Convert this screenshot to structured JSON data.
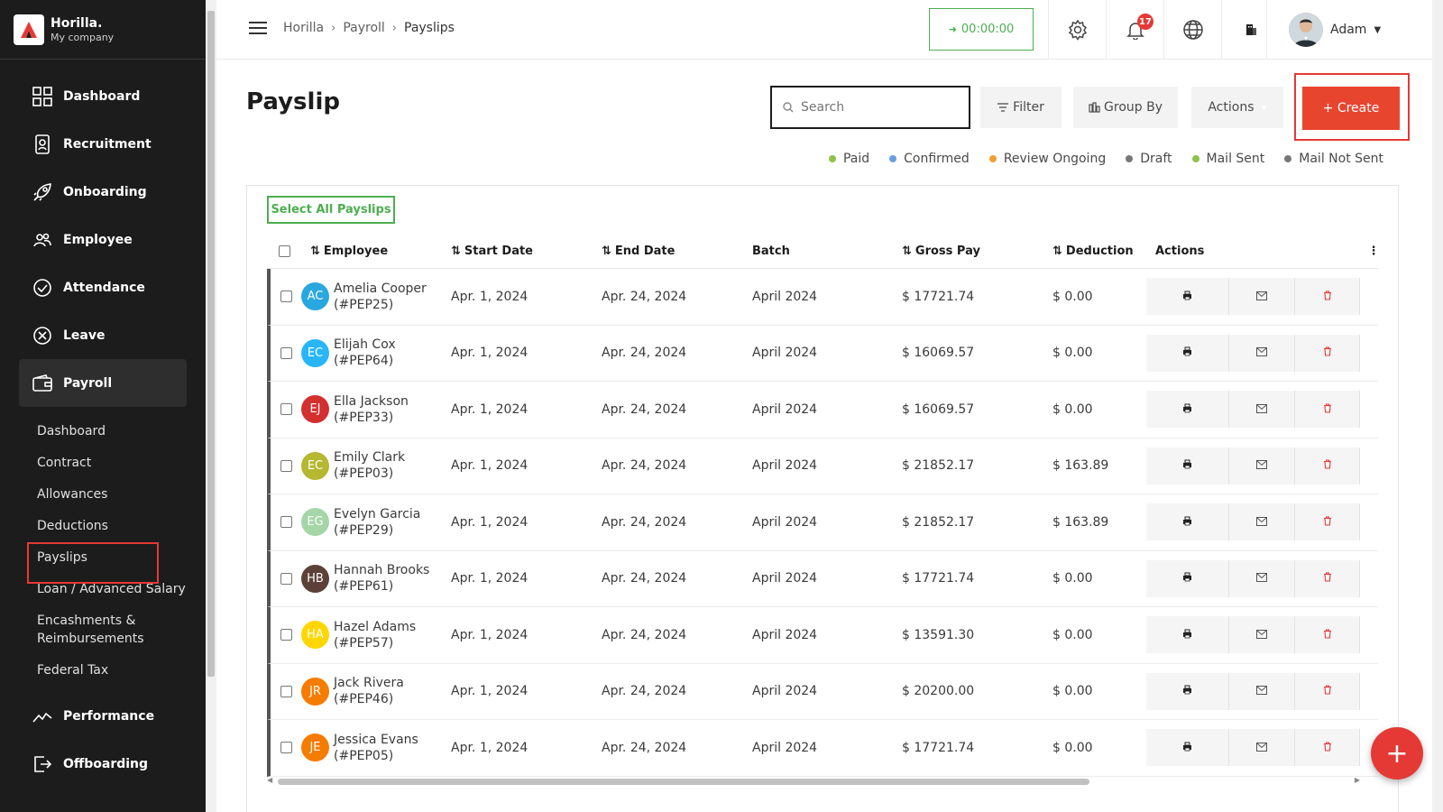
{
  "brand": {
    "name": "Horilla.",
    "company": "My company"
  },
  "sidebar": {
    "items": [
      {
        "label": "Dashboard",
        "icon": "dashboard-icon"
      },
      {
        "label": "Recruitment",
        "icon": "recruitment-icon"
      },
      {
        "label": "Onboarding",
        "icon": "rocket-icon"
      },
      {
        "label": "Employee",
        "icon": "people-icon"
      },
      {
        "label": "Attendance",
        "icon": "check-circle-icon"
      },
      {
        "label": "Leave",
        "icon": "x-circle-icon"
      },
      {
        "label": "Payroll",
        "icon": "wallet-icon"
      }
    ],
    "payroll_sub": [
      "Dashboard",
      "Contract",
      "Allowances",
      "Deductions",
      "Payslips",
      "Loan / Advanced Salary",
      "Encashments & Reimbursements",
      "Federal Tax"
    ],
    "items_after": [
      {
        "label": "Performance",
        "icon": "chart-line-icon"
      },
      {
        "label": "Offboarding",
        "icon": "exit-icon"
      }
    ]
  },
  "header": {
    "breadcrumb": [
      "Horilla",
      "Payroll",
      "Payslips"
    ],
    "timer": "00:00:00",
    "notifications": "17",
    "user": "Adam"
  },
  "page": {
    "title": "Payslip",
    "search_placeholder": "Search",
    "filter": "Filter",
    "group_by": "Group By",
    "actions": "Actions",
    "create": "+ Create",
    "select_all": "Select All Payslips"
  },
  "legend": [
    {
      "label": "Paid",
      "color": "#8bc34a"
    },
    {
      "label": "Confirmed",
      "color": "#6aa0e0"
    },
    {
      "label": "Review Ongoing",
      "color": "#f0a030"
    },
    {
      "label": "Draft",
      "color": "#777777"
    },
    {
      "label": "Mail Sent",
      "color": "#8bc34a"
    },
    {
      "label": "Mail Not Sent",
      "color": "#777777"
    }
  ],
  "table": {
    "columns": [
      "Employee",
      "Start Date",
      "End Date",
      "Batch",
      "Gross Pay",
      "Deduction",
      "Actions"
    ],
    "rows": [
      {
        "initials": "AC",
        "color": "#29a8e0",
        "name": "Amelia Cooper",
        "code": "(#PEP25)",
        "start": "Apr. 1, 2024",
        "end": "Apr. 24, 2024",
        "batch": "April 2024",
        "gross": "$ 17721.74",
        "deduction": "$ 0.00"
      },
      {
        "initials": "EC",
        "color": "#29b6f6",
        "name": "Elijah Cox",
        "code": "(#PEP64)",
        "start": "Apr. 1, 2024",
        "end": "Apr. 24, 2024",
        "batch": "April 2024",
        "gross": "$ 16069.57",
        "deduction": "$ 0.00"
      },
      {
        "initials": "EJ",
        "color": "#d32f2f",
        "name": "Ella Jackson",
        "code": "(#PEP33)",
        "start": "Apr. 1, 2024",
        "end": "Apr. 24, 2024",
        "batch": "April 2024",
        "gross": "$ 16069.57",
        "deduction": "$ 0.00"
      },
      {
        "initials": "EC",
        "color": "#b5b830",
        "name": "Emily Clark",
        "code": "(#PEP03)",
        "start": "Apr. 1, 2024",
        "end": "Apr. 24, 2024",
        "batch": "April 2024",
        "gross": "$ 21852.17",
        "deduction": "$ 163.89"
      },
      {
        "initials": "EG",
        "color": "#a5d6a7",
        "name": "Evelyn Garcia",
        "code": "(#PEP29)",
        "start": "Apr. 1, 2024",
        "end": "Apr. 24, 2024",
        "batch": "April 2024",
        "gross": "$ 21852.17",
        "deduction": "$ 163.89"
      },
      {
        "initials": "HB",
        "color": "#5d4037",
        "name": "Hannah Brooks",
        "code": "(#PEP61)",
        "start": "Apr. 1, 2024",
        "end": "Apr. 24, 2024",
        "batch": "April 2024",
        "gross": "$ 17721.74",
        "deduction": "$ 0.00"
      },
      {
        "initials": "HA",
        "color": "#ffd600",
        "name": "Hazel Adams",
        "code": "(#PEP57)",
        "start": "Apr. 1, 2024",
        "end": "Apr. 24, 2024",
        "batch": "April 2024",
        "gross": "$ 13591.30",
        "deduction": "$ 0.00"
      },
      {
        "initials": "JR",
        "color": "#f57c00",
        "name": "Jack Rivera",
        "code": "(#PEP46)",
        "start": "Apr. 1, 2024",
        "end": "Apr. 24, 2024",
        "batch": "April 2024",
        "gross": "$ 20200.00",
        "deduction": "$ 0.00"
      },
      {
        "initials": "JE",
        "color": "#f57c00",
        "name": "Jessica Evans",
        "code": "(#PEP05)",
        "start": "Apr. 1, 2024",
        "end": "Apr. 24, 2024",
        "batch": "April 2024",
        "gross": "$ 17721.74",
        "deduction": "$ 0.00"
      }
    ]
  },
  "fab": "+"
}
